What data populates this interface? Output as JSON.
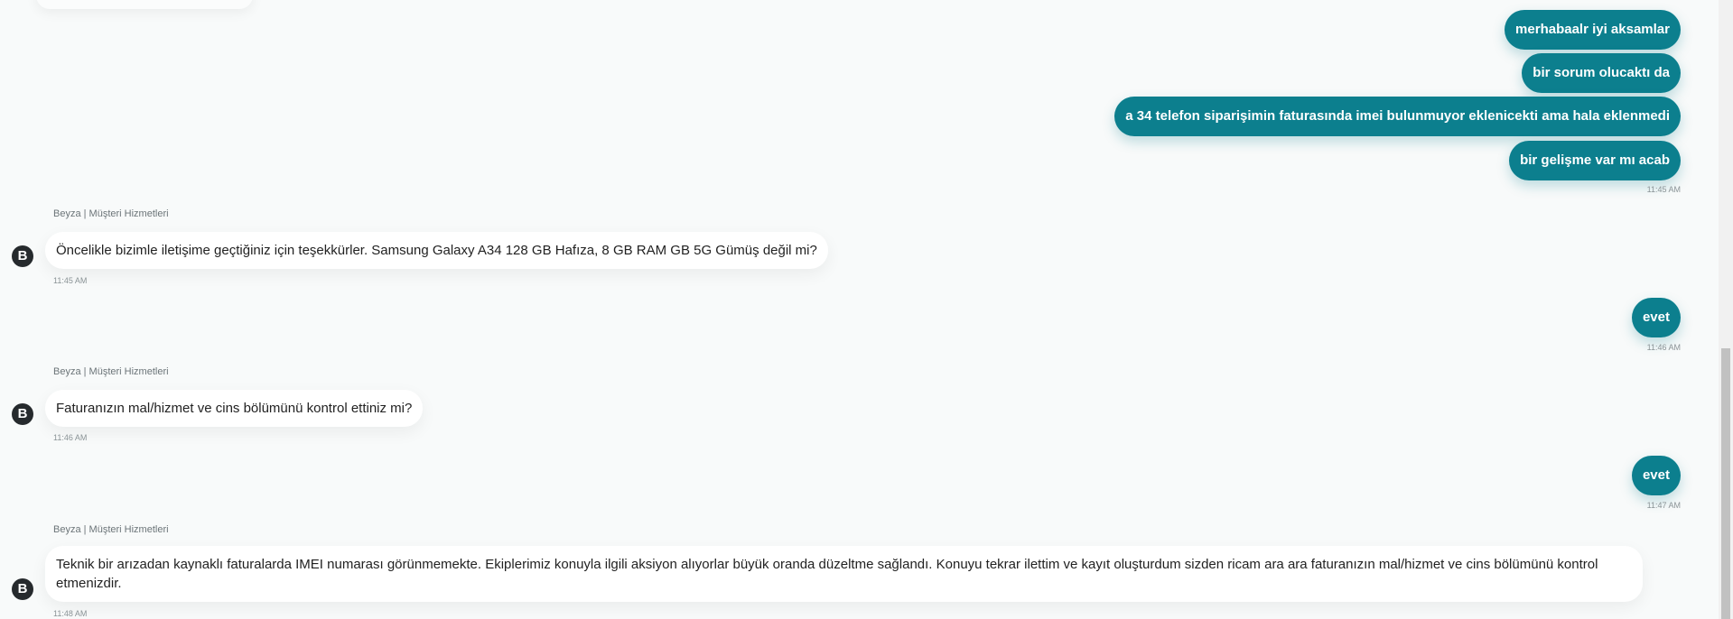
{
  "messages": {
    "user_1": "merhabaalr iyi aksamlar",
    "user_2": "bir sorum olucaktı da",
    "user_3": "a 34 telefon siparişimin faturasında imei bulunmuyor eklenicekti ama hala eklenmedi",
    "user_4": "bir gelişme var mı acab",
    "user_group_1_time": "11:45 AM",
    "agent_1_sender": "Beyza | Müşteri Hizmetleri",
    "agent_1_text": "Öncelikle bizimle iletişime geçtiğiniz için teşekkürler. Samsung Galaxy A34 128 GB Hafıza, 8 GB RAM GB 5G Gümüş değil mi?",
    "agent_1_time": "11:45 AM",
    "user_5": "evet",
    "user_5_time": "11:46 AM",
    "agent_2_sender": "Beyza | Müşteri Hizmetleri",
    "agent_2_text": "Faturanızın mal/hizmet ve cins bölümünü kontrol ettiniz mi?",
    "agent_2_time": "11:46 AM",
    "user_6": "evet",
    "user_6_time": "11:47 AM",
    "agent_3_sender": "Beyza | Müşteri Hizmetleri",
    "agent_3_text": "Teknik bir arızadan kaynaklı faturalarda IMEI numarası görünmemekte. Ekiplerimiz konuyla ilgili aksiyon alıyorlar büyük oranda düzeltme sağlandı. Konuyu tekrar ilettim ve kayıt oluşturdum sizden ricam ara ara faturanızın mal/hizmet ve cins bölümünü kontrol etmenizdir.",
    "agent_3_time": "11:48 AM"
  },
  "agent": {
    "avatar_letter": "B",
    "avatar_icon": "agent-avatar-icon"
  },
  "colors": {
    "user_bubble": "#0c7f8e",
    "agent_bubble": "#ffffff",
    "background": "#f8fafa",
    "avatar": "#262a2d"
  }
}
